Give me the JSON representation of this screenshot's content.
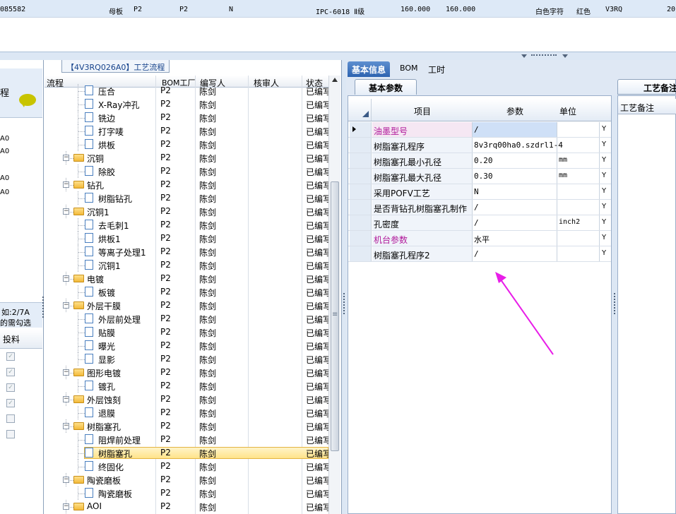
{
  "top_row": {
    "id": "085582",
    "type": "母板",
    "factory1": "P2",
    "factory2": "P2",
    "flag": "N",
    "model": "IPC-6018 Ⅱ级",
    "v1": "160.000",
    "v2": "160.000",
    "text_color": "白色字符",
    "ink_color": "红色",
    "version": "V3RQ",
    "tail": "20"
  },
  "left_panel": {
    "title_frag": "程",
    "items": [
      "A0",
      "A0",
      "A0",
      "A0"
    ],
    "note1": "如:2/7A",
    "note2": "的需勾选",
    "col": "投料"
  },
  "tree": {
    "title": "【4V3RQ026A0】工艺流程",
    "headers": {
      "flow": "流程",
      "bom": "BOM工厂",
      "writer": "编写人",
      "checker": "核审人",
      "status": "状态"
    },
    "rows": [
      {
        "name": "压合",
        "level": 2,
        "kind": "doc",
        "bom": "P2",
        "writer": "陈剑",
        "status": "已编写"
      },
      {
        "name": "X-Ray冲孔",
        "level": 2,
        "kind": "doc",
        "bom": "P2",
        "writer": "陈剑",
        "status": "已编写"
      },
      {
        "name": "铣边",
        "level": 2,
        "kind": "doc",
        "bom": "P2",
        "writer": "陈剑",
        "status": "已编写"
      },
      {
        "name": "打字唛",
        "level": 2,
        "kind": "doc",
        "bom": "P2",
        "writer": "陈剑",
        "status": "已编写"
      },
      {
        "name": "烘板",
        "level": 2,
        "kind": "doc",
        "bom": "P2",
        "writer": "陈剑",
        "status": "已编写"
      },
      {
        "name": "沉铜",
        "level": 1,
        "kind": "folder",
        "bom": "P2",
        "writer": "陈剑",
        "status": "已编写"
      },
      {
        "name": "除胶",
        "level": 2,
        "kind": "doc",
        "bom": "P2",
        "writer": "陈剑",
        "status": "已编写"
      },
      {
        "name": "钻孔",
        "level": 1,
        "kind": "folder",
        "bom": "P2",
        "writer": "陈剑",
        "status": "已编写"
      },
      {
        "name": "树脂钻孔",
        "level": 2,
        "kind": "doc",
        "bom": "P2",
        "writer": "陈剑",
        "status": "已编写"
      },
      {
        "name": "沉铜1",
        "level": 1,
        "kind": "folder",
        "bom": "P2",
        "writer": "陈剑",
        "status": "已编写"
      },
      {
        "name": "去毛刺1",
        "level": 2,
        "kind": "doc",
        "bom": "P2",
        "writer": "陈剑",
        "status": "已编写"
      },
      {
        "name": "烘板1",
        "level": 2,
        "kind": "doc",
        "bom": "P2",
        "writer": "陈剑",
        "status": "已编写"
      },
      {
        "name": "等离子处理1",
        "level": 2,
        "kind": "doc",
        "bom": "P2",
        "writer": "陈剑",
        "status": "已编写"
      },
      {
        "name": "沉铜1",
        "level": 2,
        "kind": "doc",
        "bom": "P2",
        "writer": "陈剑",
        "status": "已编写"
      },
      {
        "name": "电镀",
        "level": 1,
        "kind": "folder",
        "bom": "P2",
        "writer": "陈剑",
        "status": "已编写"
      },
      {
        "name": "板镀",
        "level": 2,
        "kind": "doc",
        "bom": "P2",
        "writer": "陈剑",
        "status": "已编写"
      },
      {
        "name": "外层干膜",
        "level": 1,
        "kind": "folder",
        "bom": "P2",
        "writer": "陈剑",
        "status": "已编写"
      },
      {
        "name": "外层前处理",
        "level": 2,
        "kind": "doc",
        "bom": "P2",
        "writer": "陈剑",
        "status": "已编写"
      },
      {
        "name": "贴膜",
        "level": 2,
        "kind": "doc",
        "bom": "P2",
        "writer": "陈剑",
        "status": "已编写"
      },
      {
        "name": "曝光",
        "level": 2,
        "kind": "doc",
        "bom": "P2",
        "writer": "陈剑",
        "status": "已编写"
      },
      {
        "name": "显影",
        "level": 2,
        "kind": "doc",
        "bom": "P2",
        "writer": "陈剑",
        "status": "已编写"
      },
      {
        "name": "图形电镀",
        "level": 1,
        "kind": "folder",
        "bom": "P2",
        "writer": "陈剑",
        "status": "已编写"
      },
      {
        "name": "镀孔",
        "level": 2,
        "kind": "doc",
        "bom": "P2",
        "writer": "陈剑",
        "status": "已编写"
      },
      {
        "name": "外层蚀刻",
        "level": 1,
        "kind": "folder",
        "bom": "P2",
        "writer": "陈剑",
        "status": "已编写"
      },
      {
        "name": "退膜",
        "level": 2,
        "kind": "doc",
        "bom": "P2",
        "writer": "陈剑",
        "status": "已编写"
      },
      {
        "name": "树脂塞孔",
        "level": 1,
        "kind": "folder",
        "bom": "P2",
        "writer": "陈剑",
        "status": "已编写"
      },
      {
        "name": "阻焊前处理",
        "level": 2,
        "kind": "doc",
        "bom": "P2",
        "writer": "陈剑",
        "status": "已编写"
      },
      {
        "name": "树脂塞孔",
        "level": 2,
        "kind": "doc",
        "bom": "P2",
        "writer": "陈剑",
        "status": "已编写",
        "selected": true
      },
      {
        "name": "终固化",
        "level": 2,
        "kind": "doc",
        "bom": "P2",
        "writer": "陈剑",
        "status": "已编写"
      },
      {
        "name": "陶瓷磨板",
        "level": 1,
        "kind": "folder",
        "bom": "P2",
        "writer": "陈剑",
        "status": "已编写"
      },
      {
        "name": "陶瓷磨板",
        "level": 2,
        "kind": "doc",
        "bom": "P2",
        "writer": "陈剑",
        "status": "已编写"
      },
      {
        "name": "AOI",
        "level": 1,
        "kind": "folder",
        "bom": "P2",
        "writer": "陈剑",
        "status": "已编写"
      }
    ]
  },
  "right": {
    "tabs": [
      "基本信息",
      "BOM",
      "工时"
    ],
    "subtab": "基本参数",
    "grid_headers": {
      "item": "项目",
      "param": "参数",
      "unit": "单位"
    },
    "rows": [
      {
        "item": "油墨型号",
        "param": "/",
        "unit": "",
        "flag": "Y",
        "pink": true,
        "current": true
      },
      {
        "item": "树脂塞孔程序",
        "param": "8v3rq00ha0.szdrl1-4",
        "unit": "",
        "flag": "Y"
      },
      {
        "item": "树脂塞孔最小孔径",
        "param": "0.20",
        "unit": "mm",
        "flag": "Y"
      },
      {
        "item": "树脂塞孔最大孔径",
        "param": "0.30",
        "unit": "mm",
        "flag": "Y"
      },
      {
        "item": "采用POFV工艺",
        "param": "N",
        "unit": "",
        "flag": "Y"
      },
      {
        "item": "是否背钻孔树脂塞孔制作",
        "param": "/",
        "unit": "",
        "flag": "Y"
      },
      {
        "item": "孔密度",
        "param": "/",
        "unit": "inch2",
        "flag": "Y"
      },
      {
        "item": "机台参数",
        "param": "水平",
        "unit": "",
        "flag": "Y",
        "pink": true
      },
      {
        "item": "树脂塞孔程序2",
        "param": "/",
        "unit": "",
        "flag": "Y"
      }
    ],
    "notes_title": "工艺备注",
    "notes_header": "工艺备注",
    "arrow_color": "#e81ee8"
  }
}
